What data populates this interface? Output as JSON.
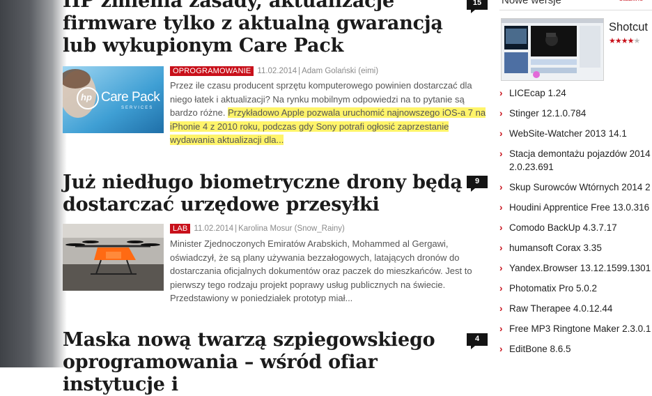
{
  "articles": [
    {
      "title": "HP zmienia zasady, aktualizacje firmware tylko z aktualną gwarancją lub wykupionym Care Pack",
      "comments": "15",
      "category": "OPROGRAMOWANIE",
      "date": "11.02.2014",
      "author": "Adam Golański (eimi)",
      "excerpt": "Przez ile czasu producent sprzętu komputerowego powinien dostarczać dla niego łatek i aktualizacji? Na rynku mobilnym odpowiedzi na to pytanie są bardzo różne. ",
      "excerpt_highlight": "Przykładowo Apple pozwala uruchomić najnowszego iOS-a 7 na iPhonie 4 z 2010 roku, podczas gdy Sony potrafi ogłosić zaprzestanie wydawania aktualizacji dla...",
      "thumb_text": "Care Pack",
      "thumb_sub": "SERVICES",
      "thumb_logo": "hp"
    },
    {
      "title": "Już niedługo biometryczne drony będą dostarczać urzędowe przesyłki",
      "comments": "9",
      "category": "LAB",
      "date": "11.02.2014",
      "author": "Karolina Mosur (Snow_Rainy)",
      "excerpt": "Minister Zjednoczonych Emiratów Arabskich, Mohammed al Gergawi, oświadczył, że są plany używania bezzałogowych, latających dronów do dostarczania oficjalnych dokumentów oraz paczek do mieszkańców. Jest to pierwszy tego rodzaju projekt poprawy usług publicznych na świecie. Przedstawiony w poniedziałek prototyp miał..."
    },
    {
      "title": "Maska nową twarzą szpiegowskiego oprogramowania – wśród ofiar instytucje i",
      "comments": "4"
    }
  ],
  "sidebar": {
    "heading": "Nowe wersje",
    "all_link": "stabilne",
    "featured": {
      "name": "Shotcut",
      "rating": 3.5
    },
    "items": [
      "LICEcap 1.24",
      "Stinger 12.1.0.784",
      "WebSite-Watcher 2013 14.1",
      "Stacja demontażu pojazdów 2014",
      "2.0.23.691",
      "Skup Surowców Wtórnych 2014 2",
      "Houdini Apprentice Free 13.0.316",
      "Comodo BackUp 4.3.7.17",
      "humansoft Corax 3.35",
      "Yandex.Browser 13.12.1599.1301",
      "Photomatix Pro 5.0.2",
      "Raw Therapee 4.0.12.44",
      "Free MP3 Ringtone Maker 2.3.0.1",
      "EditBone 8.6.5"
    ]
  }
}
